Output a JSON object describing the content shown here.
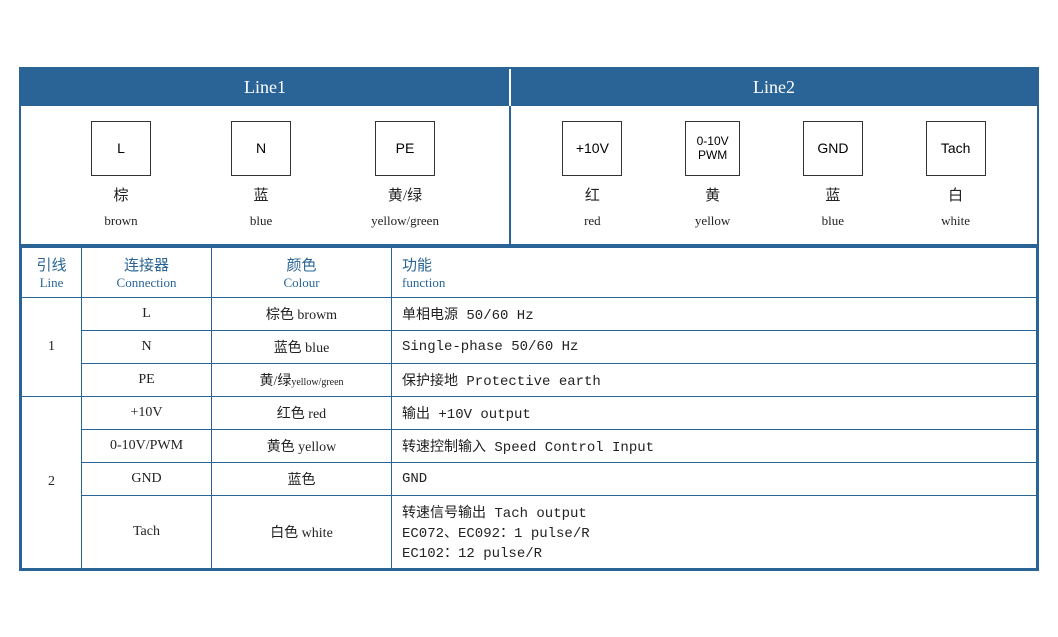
{
  "header": {
    "line1": "Line1",
    "line2": "Line2"
  },
  "diagram": {
    "line1": {
      "connectors": [
        {
          "symbol": "L",
          "cn": "棕",
          "en": "brown"
        },
        {
          "symbol": "N",
          "cn": "蓝",
          "en": "blue"
        },
        {
          "symbol": "PE",
          "cn": "黄/绿",
          "en": "yellow/green"
        }
      ]
    },
    "line2": {
      "connectors": [
        {
          "symbol": "+10V",
          "cn": "红",
          "en": "red"
        },
        {
          "symbol": "0-10V\nPWM",
          "cn": "黄",
          "en": "yellow"
        },
        {
          "symbol": "GND",
          "cn": "蓝",
          "en": "blue"
        },
        {
          "symbol": "Tach",
          "cn": "白",
          "en": "white"
        }
      ]
    }
  },
  "table": {
    "headers": {
      "line": {
        "cn": "引线",
        "en": "Line"
      },
      "connection": {
        "cn": "连接器",
        "en": "Connection"
      },
      "colour": {
        "cn": "颜色",
        "en": "Colour"
      },
      "function": {
        "cn": "功能",
        "en": "function"
      }
    },
    "rows": [
      {
        "line": "1",
        "rowspan": 3,
        "entries": [
          {
            "connection": "L",
            "colour": "棕色 browm",
            "function": "单相电源 50/60 Hz"
          },
          {
            "connection": "N",
            "colour": "蓝色 blue",
            "function": "Single-phase 50/60 Hz"
          },
          {
            "connection": "PE",
            "colour": "黄/绿yellow/green",
            "function": "保护接地 Protective earth"
          }
        ]
      },
      {
        "line": "2",
        "rowspan": 4,
        "entries": [
          {
            "connection": "+10V",
            "colour": "红色 red",
            "function": "输出 +10V output"
          },
          {
            "connection": "0-10V/PWM",
            "colour": "黄色 yellow",
            "function": "转速控制输入 Speed Control Input"
          },
          {
            "connection": "GND",
            "colour": "蓝色",
            "function": "GND"
          },
          {
            "connection": "Tach",
            "colour": "白色 white",
            "function": "转速信号输出 Tach output\nEC072、EC092：1 pulse/R\nEC102：12 pulse/R"
          }
        ]
      }
    ]
  }
}
